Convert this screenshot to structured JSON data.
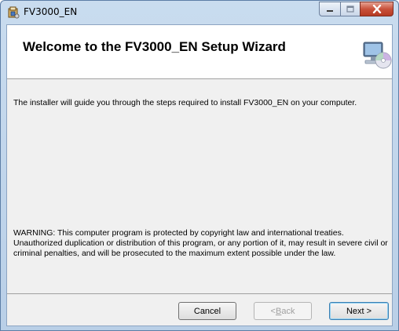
{
  "window": {
    "title": "FV3000_EN"
  },
  "banner": {
    "title": "Welcome to the FV3000_EN Setup Wizard",
    "icon": "installer-computer-cd-icon"
  },
  "body": {
    "intro": "The installer will guide you through the steps required to install FV3000_EN on your computer.",
    "warning": "WARNING: This computer program is protected by copyright law and international treaties. Unauthorized duplication or distribution of this program, or any portion of it, may result in severe civil or criminal penalties, and will be prosecuted to the maximum extent possible under the law."
  },
  "buttons": {
    "cancel": "Cancel",
    "back_prefix": "< ",
    "back_mnemonic": "B",
    "back_rest": "ack",
    "next": "Next >"
  },
  "colors": {
    "close_button": "#c8523b",
    "next_focus": "#3c7fb1"
  }
}
